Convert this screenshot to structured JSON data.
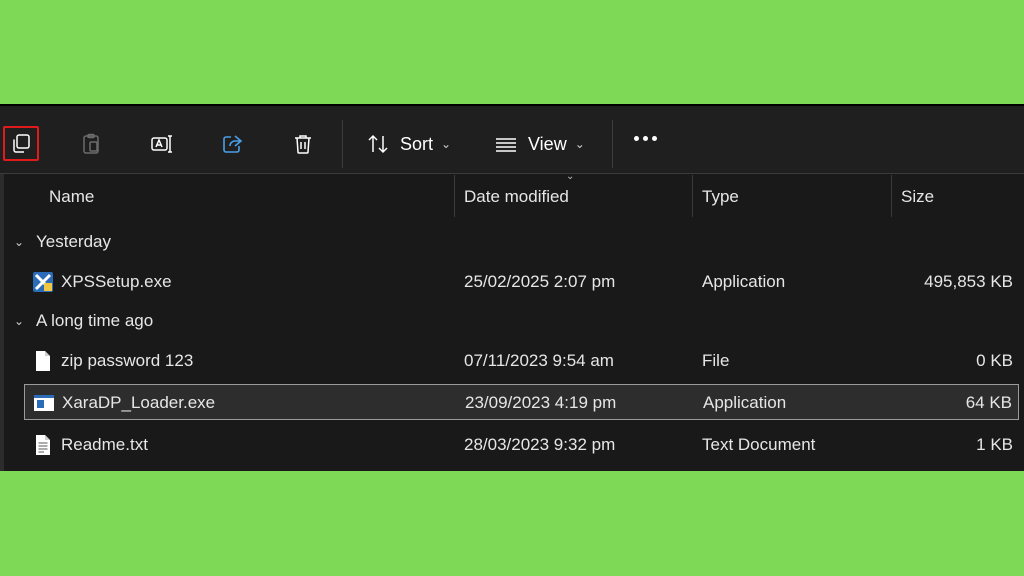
{
  "toolbar": {
    "icons": [
      "copy-icon",
      "paste-icon",
      "rename-icon",
      "share-icon",
      "delete-icon"
    ],
    "sort_label": "Sort",
    "view_label": "View",
    "more_label": "•••"
  },
  "columns": {
    "name": "Name",
    "date_modified": "Date modified",
    "type": "Type",
    "size": "Size"
  },
  "groups": [
    {
      "label": "Yesterday",
      "files": [
        {
          "name": "XPSSetup.exe",
          "date": "25/02/2025 2:07 pm",
          "type": "Application",
          "size": "495,853 KB",
          "icon": "xps-exe-icon"
        }
      ]
    },
    {
      "label": "A long time ago",
      "files": [
        {
          "name": "zip password 123",
          "date": "07/11/2023 9:54 am",
          "type": "File",
          "size": "0 KB",
          "icon": "blank-file-icon"
        },
        {
          "name": "XaraDP_Loader.exe",
          "date": "23/09/2023 4:19 pm",
          "type": "Application",
          "size": "64 KB",
          "icon": "app-window-icon",
          "selected": true
        },
        {
          "name": "Readme.txt",
          "date": "28/03/2023 9:32 pm",
          "type": "Text Document",
          "size": "1 KB",
          "icon": "text-file-icon"
        }
      ]
    }
  ],
  "colors": {
    "background": "#7ed957",
    "window": "#191919",
    "highlight": "#e11b1b",
    "accent": "#4a9fe8"
  }
}
